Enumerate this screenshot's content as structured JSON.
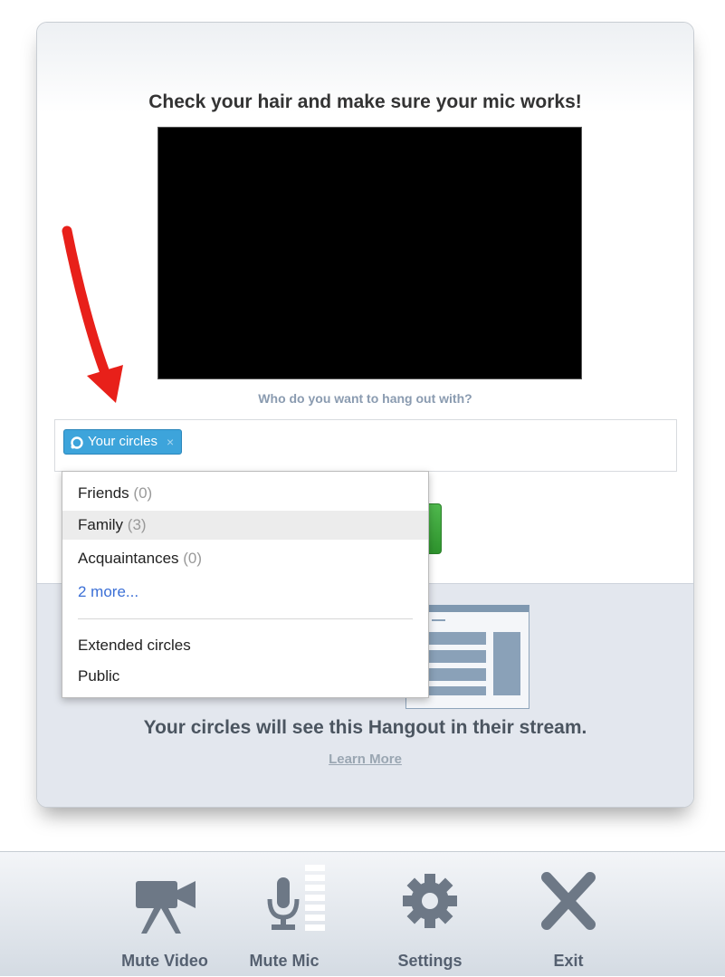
{
  "card": {
    "heading": "Check your hair and make sure your mic works!",
    "who_prompt": "Who do you want to hang out with?",
    "share_chip": {
      "label": "Your circles",
      "remove_glyph": "×"
    },
    "stream_text": "Your circles will see this Hangout in their stream.",
    "learn_more": "Learn More"
  },
  "dropdown": {
    "items": [
      {
        "label": "Friends",
        "count": "(0)"
      },
      {
        "label": "Family",
        "count": "(3)",
        "highlighted": true
      },
      {
        "label": "Acquaintances",
        "count": "(0)"
      }
    ],
    "more_link": "2 more...",
    "extended": "Extended circles",
    "public": "Public"
  },
  "toolbar": {
    "buttons": [
      {
        "label": "Mute Video",
        "icon": "video-camera-icon"
      },
      {
        "label": "Mute Mic",
        "icon": "microphone-icon"
      },
      {
        "label": "Settings",
        "icon": "gear-icon"
      },
      {
        "label": "Exit",
        "icon": "close-icon"
      }
    ]
  },
  "colors": {
    "chip_blue": "#3da4db",
    "join_green": "#3aa638",
    "annotation_arrow": "#e8201a",
    "link_blue": "#3b6fd6"
  }
}
